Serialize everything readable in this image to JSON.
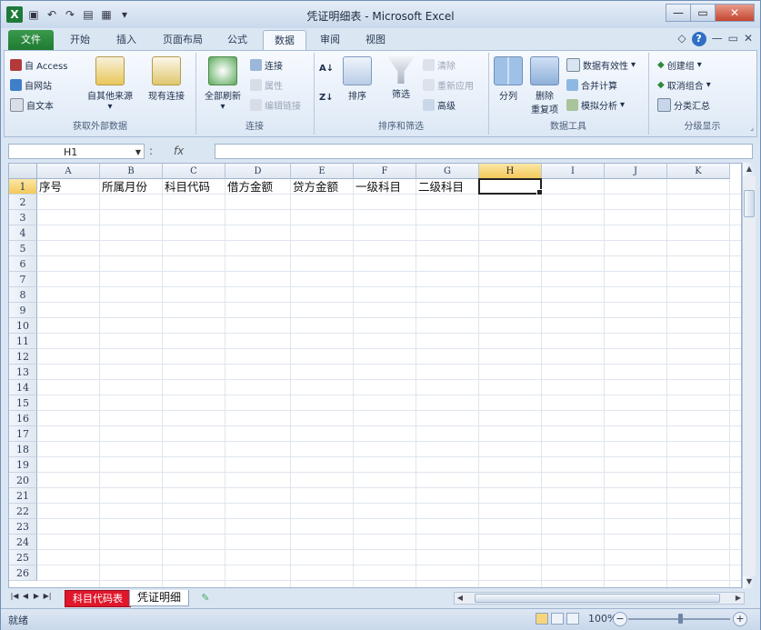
{
  "window": {
    "title": "凭证明细表 - Microsoft Excel",
    "controls": [
      "—",
      "▭",
      "✕"
    ]
  },
  "qat": {
    "app_icon": "X",
    "icons": [
      "save-icon",
      "undo-icon",
      "redo-icon",
      "print-preview-icon",
      "quick-print-icon",
      "qat-dropdown-icon"
    ]
  },
  "tabs": [
    {
      "label": "文件",
      "type": "file"
    },
    {
      "label": "开始"
    },
    {
      "label": "插入"
    },
    {
      "label": "页面布局"
    },
    {
      "label": "公式"
    },
    {
      "label": "数据",
      "active": true
    },
    {
      "label": "审阅"
    },
    {
      "label": "视图"
    }
  ],
  "ribbon": {
    "get_external": {
      "label": "获取外部数据",
      "access": "自 Access",
      "web": "自网站",
      "text": "自文本",
      "other": "自其他来源",
      "existing": "现有连接"
    },
    "connections": {
      "label": "连接",
      "refresh_all": "全部刷新",
      "connections": "连接",
      "properties": "属性",
      "edit_links": "编辑链接"
    },
    "sort_filter": {
      "label": "排序和筛选",
      "sort": "排序",
      "filter": "筛选",
      "clear": "清除",
      "reapply": "重新应用",
      "advanced": "高级"
    },
    "data_tools": {
      "label": "数据工具",
      "text_to_columns": "分列",
      "remove_dup_1": "删除",
      "remove_dup_2": "重复项",
      "validation": "数据有效性",
      "consolidate": "合并计算",
      "what_if": "模拟分析"
    },
    "outline": {
      "label": "分级显示",
      "group": "创建组",
      "ungroup": "取消组合",
      "subtotal": "分类汇总"
    }
  },
  "formula_bar": {
    "name_box": "H1",
    "fx": "fx",
    "value": ""
  },
  "columns": [
    "A",
    "B",
    "C",
    "D",
    "E",
    "F",
    "G",
    "H",
    "I",
    "J",
    "K"
  ],
  "selected_column": "H",
  "rows": [
    "1",
    "2",
    "3",
    "4",
    "5",
    "6",
    "7",
    "8",
    "9",
    "10",
    "11",
    "12",
    "13",
    "14",
    "15",
    "16",
    "17",
    "18",
    "19",
    "20",
    "21",
    "22",
    "23",
    "24",
    "25",
    "26"
  ],
  "header_row": [
    "序号",
    "所属月份",
    "科目代码",
    "借方金额",
    "贷方金额",
    "一级科目",
    "二级科目"
  ],
  "sheets": [
    {
      "name": "科目代码表",
      "color": "#e0162b"
    },
    {
      "name": "凭证明细",
      "active": true
    }
  ],
  "status": {
    "ready": "就绪",
    "zoom": "100%"
  }
}
